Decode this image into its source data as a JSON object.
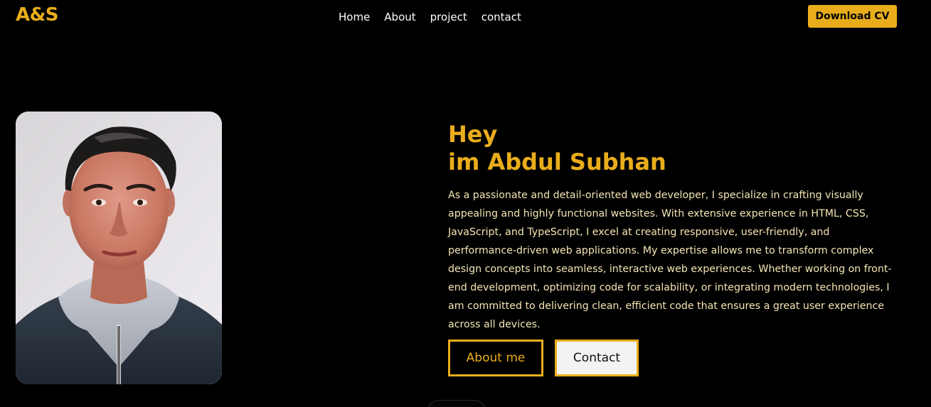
{
  "header": {
    "logo": "A&S",
    "nav": [
      {
        "label": "Home"
      },
      {
        "label": "About"
      },
      {
        "label": "project"
      },
      {
        "label": "contact"
      }
    ],
    "download_label": "Download CV"
  },
  "hero": {
    "greeting": "Hey",
    "name_line": "im Abdul Subhan",
    "description": "As a passionate and detail-oriented web developer, I specialize in crafting visually appealing and highly functional websites. With extensive experience in HTML, CSS, JavaScript, and TypeScript, I excel at creating responsive, user-friendly, and performance-driven web applications. My expertise allows me to transform complex design concepts into seamless, interactive web experiences. Whether working on front-end development, optimizing code for scalability, or integrating modern technologies, I am committed to delivering clean, efficient code that ensures a great user experience across all devices.",
    "about_button": "About me",
    "contact_button": "Contact"
  },
  "colors": {
    "background": "#000000",
    "accent": "#e9ad1c",
    "nav_text": "#ffffff",
    "body_text": "#f4e6b4",
    "light_button": "#f3f3f4"
  }
}
